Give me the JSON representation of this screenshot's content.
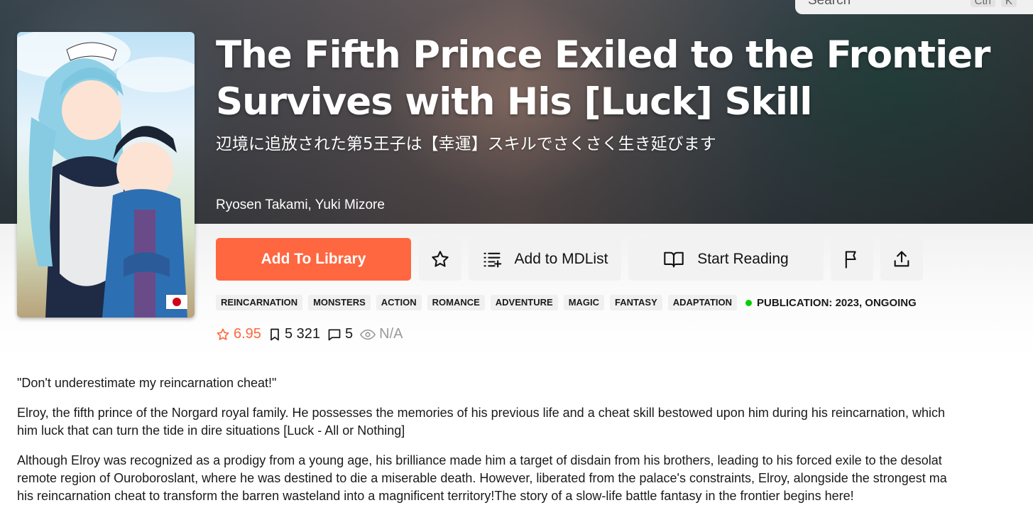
{
  "search": {
    "placeholder": "Search",
    "shortcut": [
      "Ctrl",
      "K"
    ]
  },
  "manga": {
    "title_line1": "The Fifth Prince Exiled to the Frontier",
    "title_line2": "Survives with His [Luck] Skill",
    "alt_title": "辺境に追放された第5王子は【幸運】スキルでさくさく生き延びます",
    "authors": "Ryosen Takami, Yuki Mizore",
    "original_language_flag": "japan-flag-icon"
  },
  "actions": {
    "add_to_library": "Add To Library",
    "add_to_mdlist": "Add to MDList",
    "start_reading": "Start Reading"
  },
  "tags": [
    "REINCARNATION",
    "MONSTERS",
    "ACTION",
    "ROMANCE",
    "ADVENTURE",
    "MAGIC",
    "FANTASY",
    "ADAPTATION"
  ],
  "publication": "PUBLICATION: 2023, ONGOING",
  "stats": {
    "rating": "6.95",
    "follows": "5 321",
    "comments": "5",
    "views": "N/A"
  },
  "description": {
    "p1": "\"Don't underestimate my reincarnation cheat!\"",
    "p2_l1": "Elroy, the fifth prince of the Norgard royal family. He possesses the memories of his previous life and a cheat skill bestowed upon him during his reincarnation, which",
    "p2_l2": "him luck that can turn the tide in dire situations [Luck - All or Nothing]",
    "p3_l1": "Although Elroy was recognized as a prodigy from a young age, his brilliance made him a target of disdain from his brothers, leading to his forced exile to the desolat",
    "p3_l2": "remote region of Ouroboroslant, where he was destined to die a miserable death. However, liberated from the palace's constraints, Elroy, alongside the strongest ma",
    "p3_l3": "his reincarnation cheat to transform the barren wasteland into a magnificent territory!The story of a slow-life battle fantasy in the frontier begins here!"
  },
  "colors": {
    "accent": "#ff6740",
    "status_dot": "#04d000",
    "tag_bg": "#f0f0f0"
  }
}
